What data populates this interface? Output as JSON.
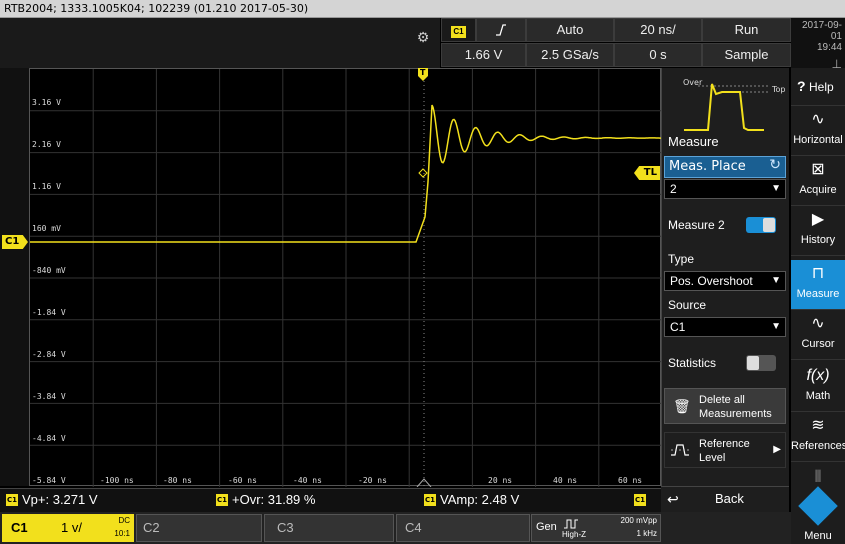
{
  "titlebar": {
    "text": "RTB2004; 1333.1005K04; 102239 (01.210 2017-05-30)"
  },
  "header": {
    "channel_tag": "C1",
    "trigger_slope_icon": "rising-edge-icon",
    "trigger_mode": "Auto",
    "time_scale": "20 ns/",
    "run_state": "Run",
    "trigger_level": "1.66 V",
    "sample_rate": "2.5 GSa/s",
    "time_offset": "0 s",
    "acq_mode": "Sample",
    "date": "2017-09-01",
    "time": "19:44"
  },
  "scope": {
    "y_labels": [
      "3.16 V",
      "2.16 V",
      "1.16 V",
      "160 mV",
      "-840 mV",
      "-1.84 V",
      "-2.84 V",
      "-3.84 V",
      "-4.84 V",
      "-5.84 V"
    ],
    "x_labels": [
      "-100 ns",
      "-80 ns",
      "-60 ns",
      "-40 ns",
      "-20 ns",
      "20 ns",
      "40 ns",
      "60 ns"
    ],
    "channel_marker": "C1",
    "trigger_level_marker": "TL",
    "trigger_pos_marker": "T"
  },
  "measure_panel": {
    "preview_over": "Over",
    "preview_top": "Top",
    "title": "Measure",
    "meas_place_label": "Meas. Place",
    "meas_place_value": "2",
    "measure_name": "Measure 2",
    "measure_enabled": true,
    "type_label": "Type",
    "type_value": "Pos. Overshoot",
    "source_label": "Source",
    "source_value": "C1",
    "statistics_label": "Statistics",
    "statistics_enabled": false,
    "delete_all_line1": "Delete all",
    "delete_all_line2": "Measurements",
    "reference_line1": "Reference",
    "reference_line2": "Level",
    "back_label": "Back"
  },
  "sidebar": {
    "items": [
      {
        "label": "Help",
        "icon": "help-icon"
      },
      {
        "label": "Horizontal",
        "icon": "horizontal-icon"
      },
      {
        "label": "Acquire",
        "icon": "acquire-icon"
      },
      {
        "label": "History",
        "icon": "history-icon"
      },
      {
        "label": "Measure",
        "icon": "measure-icon"
      },
      {
        "label": "Cursor",
        "icon": "cursor-icon"
      },
      {
        "label": "Math",
        "icon": "math-icon"
      },
      {
        "label": "References",
        "icon": "references-icon"
      },
      {
        "label": "Menu",
        "icon": "menu-icon"
      }
    ]
  },
  "measurements": [
    {
      "tag": "C1",
      "text": "Vp+: 3.271 V"
    },
    {
      "tag": "C1",
      "text": "+Ovr: 31.89 %"
    },
    {
      "tag": "C1",
      "text": "VAmp: 2.48 V"
    }
  ],
  "channels": {
    "c1": {
      "name": "C1",
      "scale": "1 v/",
      "coupling": "DC",
      "ratio": "10:1"
    },
    "c2": {
      "name": "C2"
    },
    "c3": {
      "name": "C3"
    },
    "c4": {
      "name": "C4"
    },
    "gen": {
      "name": "Gen",
      "wave_icon": "square-wave-icon",
      "impedance": "High-Z",
      "amplitude": "200 mVpp",
      "freq": "1 kHz"
    }
  },
  "colors": {
    "trace": "#f2e01c",
    "accent": "#1a8fd6"
  }
}
